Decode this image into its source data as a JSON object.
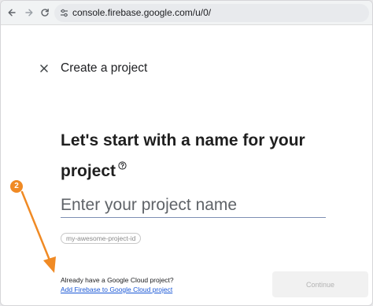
{
  "browser": {
    "url": "console.firebase.google.com/u/0/",
    "icons": {
      "back": "arrow-left-icon",
      "forward": "arrow-right-icon",
      "reload": "reload-icon",
      "site_info": "tune-icon"
    }
  },
  "dialog": {
    "title": "Create a project",
    "close_icon": "close-icon",
    "heading": "Let's start with a name for your project",
    "help_icon": "help-circle-icon",
    "project_name_placeholder": "Enter your project name",
    "project_name_value": "",
    "project_id_chip": "my-awesome-project-id",
    "gcp_question": "Already have a Google Cloud project?",
    "gcp_link": "Add Firebase to Google Cloud project",
    "continue_label": "Continue"
  },
  "annotation": {
    "step_number": "2",
    "color": "#f08a24"
  },
  "colors": {
    "link": "#1a57d6",
    "input_underline": "#7d8fb3",
    "disabled_button": "#f1f1f1"
  }
}
